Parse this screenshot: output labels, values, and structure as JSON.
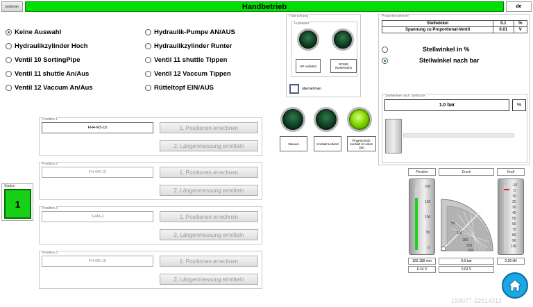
{
  "header": {
    "left_button": "bediener",
    "title": "Handbetrieb",
    "lang": "de"
  },
  "mode_options": [
    {
      "label": "Keine Auswahl",
      "checked": true
    },
    {
      "label": "Hydraulikzylinder Hoch",
      "checked": false
    },
    {
      "label": "Ventil 10 SortingPipe",
      "checked": false
    },
    {
      "label": "Ventil 11 shuttle An/Aus",
      "checked": false
    },
    {
      "label": "Ventil 12 Vaccum An/Aus",
      "checked": false
    },
    {
      "label": "Hydraulik-Pumpe AN/AUS",
      "checked": false
    },
    {
      "label": "Hydraulikzylinder Runter",
      "checked": false
    },
    {
      "label": "Ventil 11 shuttle Tippen",
      "checked": false
    },
    {
      "label": "Ventil 12 Vaccum Tippen",
      "checked": false
    },
    {
      "label": "Rütteltopf EIN/AUS",
      "checked": false
    }
  ],
  "hubrichtung": {
    "title": "Hubrichtung",
    "fusstaster_title": "Fußtaster",
    "up_label": "UP Aufwärts",
    "down_label": "DOWN Runterwärts",
    "uebernehmen": "übernehmen"
  },
  "status_lamps": [
    {
      "label": "Vakuum",
      "on": false
    },
    {
      "label": "Kontakt Leitend",
      "on": false
    },
    {
      "label": "Fingerschutz-kontakt ist unten (ok)",
      "on": true
    }
  ],
  "proportional": {
    "title": "Proportionalventil",
    "rows": [
      {
        "name": "Stellwinkel",
        "value": "0.1",
        "unit": "%"
      },
      {
        "name": "Spannung zu Proportional-Ventil",
        "value": "0.01",
        "unit": "V"
      }
    ],
    "options": [
      {
        "label": "Stellwinkel in %",
        "checked": false
      },
      {
        "label": "Stellwinkel nach bar",
        "checked": true
      }
    ],
    "solldruck_title": "Stellwinkel nach Solldruck",
    "solldruck_value": "1.0 bar",
    "solldruck_unit": "%"
  },
  "station": {
    "label": "Station",
    "value": "1"
  },
  "positions": [
    {
      "title": "Position 1",
      "field": "FH4-M5-15",
      "active": true,
      "btn1": "1. Positionen errechnen",
      "btn2": "2. Längenmessung ermitteln"
    },
    {
      "title": "Position 2",
      "field": "FH-M4-12",
      "active": false,
      "btn1": "1. Positionen errechnen",
      "btn2": "2. Längenmessung ermitteln"
    },
    {
      "title": "Position 3",
      "field": "S-M4-2",
      "active": false,
      "btn1": "1. Positionen errechnen",
      "btn2": "2. Längenmessung ermitteln"
    },
    {
      "title": "Position 3",
      "field": "FH-M5-15",
      "active": false,
      "btn1": "1. Positionen errechnen",
      "btn2": "2. Längenmessung ermitteln"
    }
  ],
  "gauges": {
    "position": {
      "title": "Position",
      "ticks": [
        "200",
        "150",
        "100",
        "50",
        "0"
      ],
      "value1": "162.158 mm",
      "value2": "6.24 V",
      "level": 0.81
    },
    "druck": {
      "title": "Druck",
      "ticks": [
        "50",
        "100",
        "150",
        "200",
        "250"
      ],
      "value1": "0.6 bar",
      "value2": "0.02 V"
    },
    "kraft": {
      "title": "Kraft",
      "ticks": [
        "-10",
        "0",
        "10",
        "20",
        "30",
        "40",
        "50",
        "60",
        "70",
        "80",
        "90",
        "100"
      ],
      "value1": "0.26 kN"
    }
  },
  "home_icon": "home-icon",
  "watermark": "159077-22514312",
  "colors": {
    "title_green": "#00e000",
    "lamp_on": "#7ed400",
    "lamp_off": "#0f3b22",
    "station_green": "#17d117",
    "home_blue": "#1aa7e6"
  }
}
